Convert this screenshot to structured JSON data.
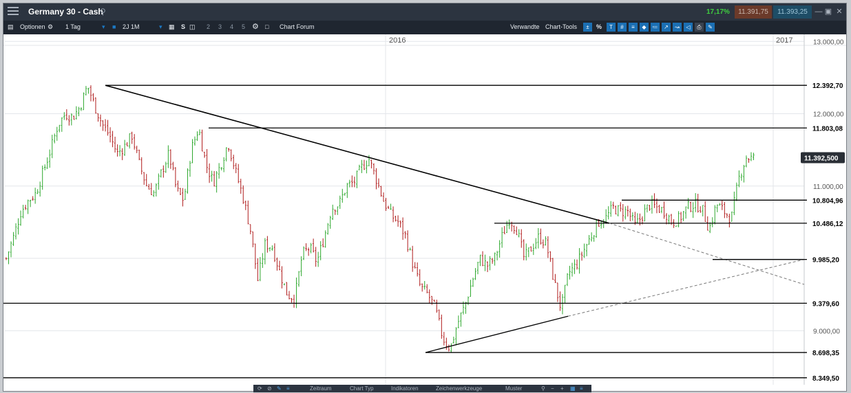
{
  "header": {
    "title": "Germany 30 - Cash",
    "change_pct": "17,17%",
    "sell_price": "11.391,75",
    "buy_price": "11.393,25"
  },
  "toolbar": {
    "options_label": "Optionen",
    "interval_label": "1 Tag",
    "range_label": "2J 1M",
    "s_label": "S",
    "pages": [
      "2",
      "3",
      "4",
      "5"
    ],
    "forum_label": "Chart Forum",
    "related_label": "Verwandte",
    "tools_label": "Chart-Tools",
    "percent_label": "%"
  },
  "bottom_bar": {
    "tabs": [
      "Zeitraum",
      "Chart Typ",
      "Indikatoren",
      "Zeichenwerkzeuge",
      "Muster"
    ]
  },
  "colors": {
    "up": "#2ea82e",
    "down": "#b01c1c",
    "line": "#000000",
    "dashed": "#777777",
    "current_price_bg": "#2a2f36"
  },
  "chart_data": {
    "type": "candlestick",
    "instrument": "Germany 30 - Cash",
    "x_labels": [
      "2016",
      "2017"
    ],
    "y_ticks": [
      9000,
      10000,
      11000,
      12000,
      13000
    ],
    "y_tick_labels": [
      "9.000,00",
      "10.000,00",
      "11.000,00",
      "12.000,00",
      "13.000,00"
    ],
    "ylim": [
      8300,
      13050
    ],
    "horizontal_levels": [
      {
        "value": 12392.7,
        "label": "12.392,70"
      },
      {
        "value": 11803.08,
        "label": "11.803,08"
      },
      {
        "value": 10804.96,
        "label": "10.804,96"
      },
      {
        "value": 10486.12,
        "label": "10.486,12"
      },
      {
        "value": 9985.2,
        "label": "9.985,20"
      },
      {
        "value": 9379.6,
        "label": "9.379,60"
      },
      {
        "value": 8698.35,
        "label": "8.698,35"
      },
      {
        "value": 8349.5,
        "label": "8.349,50"
      }
    ],
    "current_price": {
      "value": 11392.5,
      "label": "11.392,500"
    },
    "price_path": [
      10000,
      10300,
      10650,
      10800,
      10900,
      11200,
      11500,
      11850,
      12000,
      11950,
      12100,
      12390,
      12100,
      11850,
      11700,
      11450,
      11550,
      11700,
      11300,
      11000,
      10900,
      11200,
      11450,
      10950,
      10800,
      11500,
      11800,
      11300,
      11050,
      11300,
      11600,
      11200,
      10850,
      10400,
      9700,
      10200,
      10150,
      9800,
      9500,
      9450,
      10050,
      10150,
      9950,
      10300,
      10700,
      10750,
      11000,
      11050,
      11250,
      11380,
      11100,
      10800,
      10600,
      10500,
      10300,
      9900,
      9600,
      9500,
      9300,
      8900,
      8750,
      9100,
      9350,
      9700,
      10000,
      9900,
      10000,
      10300,
      10550,
      10400,
      10000,
      10150,
      10300,
      10200,
      9700,
      9300,
      9800,
      9900,
      10100,
      10300,
      10500,
      10550,
      10700,
      10650,
      10650,
      10450,
      10600,
      10750,
      10700,
      10650,
      10500,
      10550,
      10700,
      10750,
      10700,
      10400,
      10750,
      10650,
      10550,
      11100,
      11400,
      11380
    ]
  }
}
